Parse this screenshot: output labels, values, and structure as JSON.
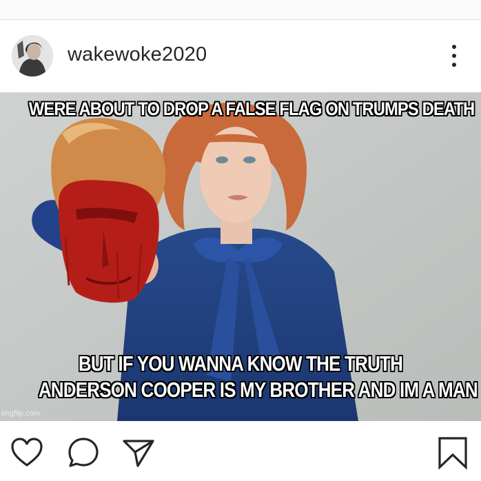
{
  "post": {
    "username": "wakewoke2020",
    "more_icon": "more-vertical-icon",
    "avatar_icon": "avatar-photo-icon"
  },
  "meme": {
    "top_text": "WERE ABOUT TO DROP A FALSE FLAG ON TRUMPS DEATH",
    "bottom_line_1": "BUT IF YOU WANNA KNOW THE TRUTH",
    "bottom_line_2": "ANDERSON COOPER IS MY BROTHER AND IM A MAN",
    "watermark": "imgflip.com"
  },
  "actions": {
    "like_icon": "heart-icon",
    "comment_icon": "comment-icon",
    "share_icon": "send-icon",
    "save_icon": "bookmark-icon"
  },
  "colors": {
    "text": "#262626",
    "divider": "#dbdbdb",
    "background": "#ffffff"
  }
}
